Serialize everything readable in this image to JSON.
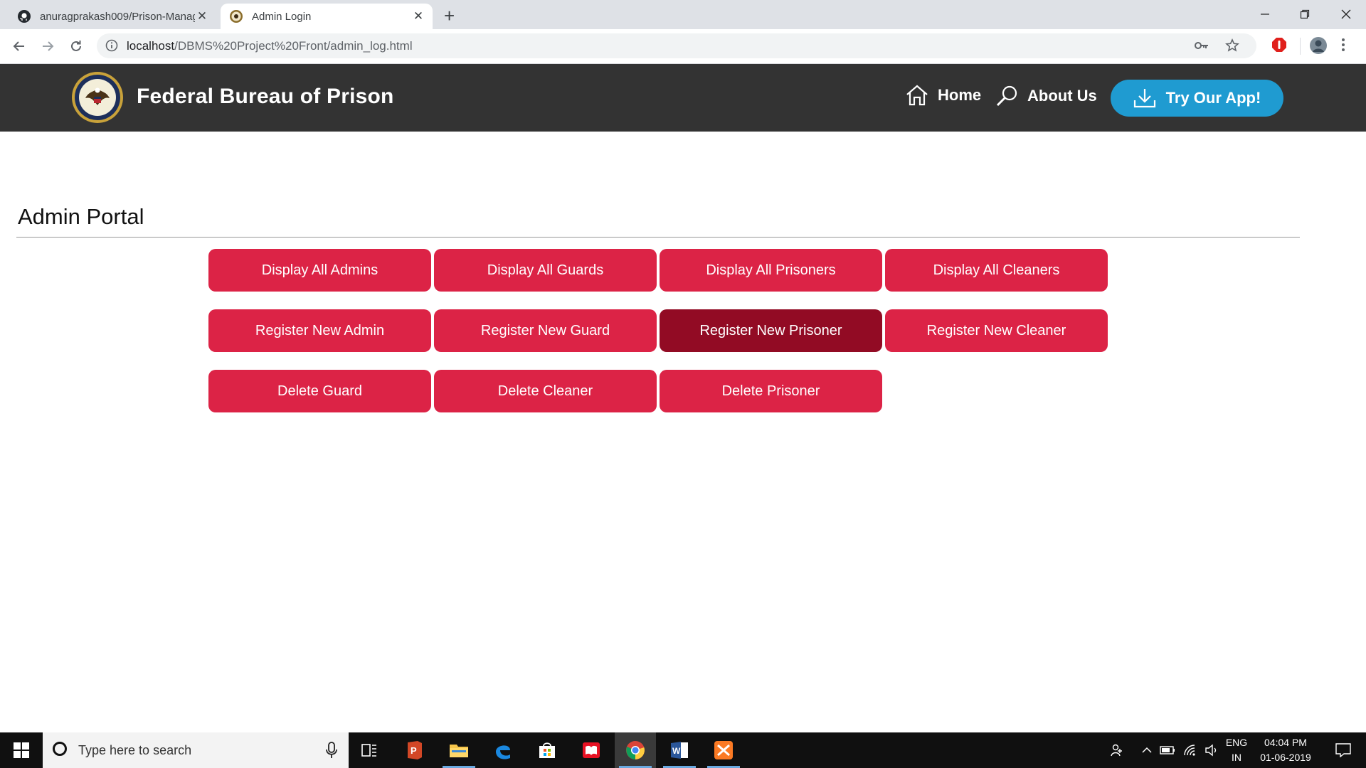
{
  "browser": {
    "tabs": [
      {
        "title": "anuragprakash009/Prison-Manag",
        "active": false
      },
      {
        "title": "Admin Login",
        "active": true
      }
    ],
    "url_host": "localhost",
    "url_path": "/DBMS%20Project%20Front/admin_log.html"
  },
  "site": {
    "title": "Federal Bureau of Prison",
    "nav": {
      "home": "Home",
      "about": "About Us",
      "app": "Try Our App!"
    }
  },
  "portal": {
    "title": "Admin Portal",
    "buttons": [
      {
        "label": "Display All Admins",
        "active": false
      },
      {
        "label": "Display All Guards",
        "active": false
      },
      {
        "label": "Display All Prisoners",
        "active": false
      },
      {
        "label": "Display All Cleaners",
        "active": false
      },
      {
        "label": "Register New Admin",
        "active": false
      },
      {
        "label": "Register New Guard",
        "active": false
      },
      {
        "label": "Register New Prisoner",
        "active": true
      },
      {
        "label": "Register New Cleaner",
        "active": false
      },
      {
        "label": "Delete Guard",
        "active": false
      },
      {
        "label": "Delete Cleaner",
        "active": false
      },
      {
        "label": "Delete Prisoner",
        "active": false
      }
    ]
  },
  "colors": {
    "header_bg": "#333333",
    "button": "#dc2346",
    "button_active": "#920b24",
    "app_button": "#1f9bd1"
  },
  "taskbar": {
    "search_placeholder": "Type here to search",
    "lang": "ENG",
    "region": "IN",
    "time": "04:04 PM",
    "date": "01-06-2019"
  }
}
